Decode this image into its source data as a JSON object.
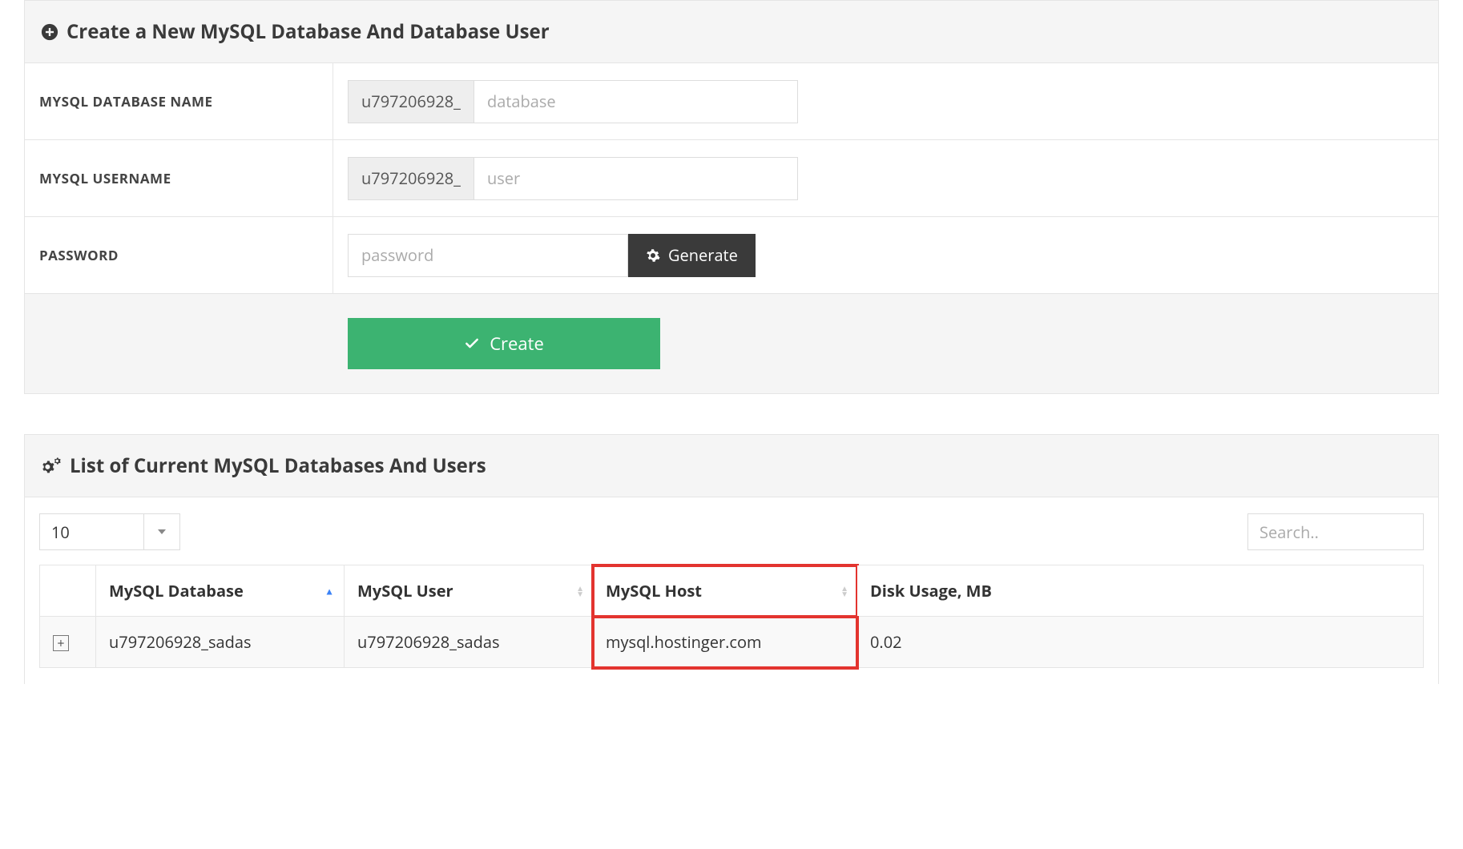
{
  "create_panel": {
    "title": "Create a New MySQL Database And Database User",
    "fields": {
      "db_name_label": "MYSQL DATABASE NAME",
      "db_name_prefix": "u797206928_",
      "db_name_placeholder": "database",
      "username_label": "MYSQL USERNAME",
      "username_prefix": "u797206928_",
      "username_placeholder": "user",
      "password_label": "PASSWORD",
      "password_placeholder": "password",
      "generate_button": "Generate",
      "create_button": "Create"
    }
  },
  "list_panel": {
    "title": "List of Current MySQL Databases And Users",
    "page_length": "10",
    "search_placeholder": "Search..",
    "columns": {
      "database": "MySQL Database",
      "user": "MySQL User",
      "host": "MySQL Host",
      "disk": "Disk Usage, MB"
    },
    "rows": [
      {
        "database": "u797206928_sadas",
        "user": "u797206928_sadas",
        "host": "mysql.hostinger.com",
        "disk": "0.02"
      }
    ]
  }
}
